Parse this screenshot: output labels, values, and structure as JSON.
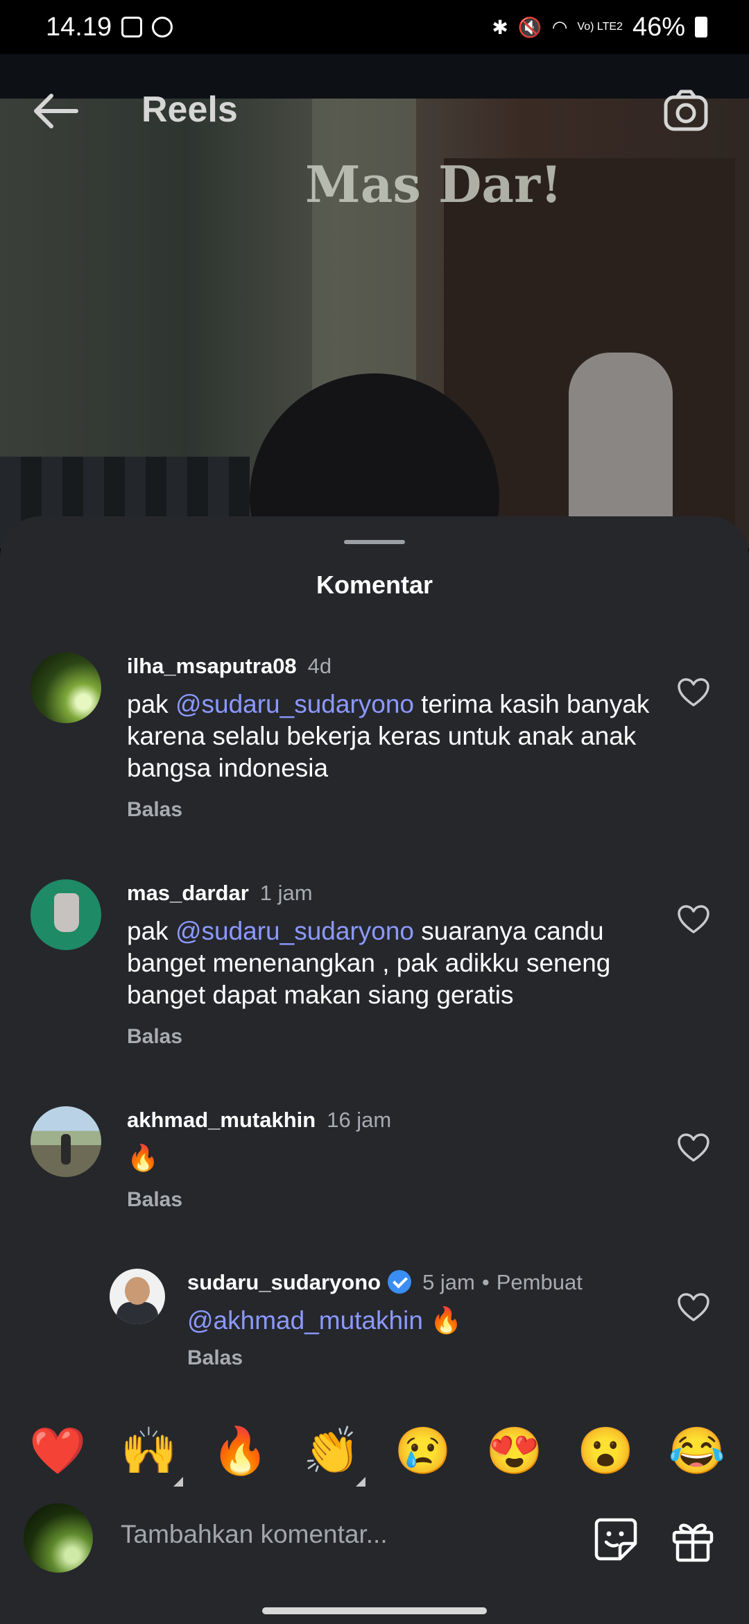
{
  "status_bar": {
    "time": "14.19",
    "battery": "46%",
    "network": "Vo) LTE2"
  },
  "header": {
    "title": "Reels",
    "watermark": "Mas Dar!"
  },
  "sheet": {
    "title": "Komentar"
  },
  "comments": [
    {
      "username": "ilha_msaputra08",
      "time": "4d",
      "mention": "@sudaru_sudaryono",
      "prefix": "pak ",
      "text": " terima kasih banyak karena selalu bekerja keras untuk anak anak bangsa indonesia",
      "reply_label": "Balas"
    },
    {
      "username": "mas_dardar",
      "time": "1 jam",
      "mention": "@sudaru_sudaryono",
      "prefix": "pak ",
      "text": " suaranya candu banget menenangkan , pak adikku seneng banget dapat makan siang geratis",
      "reply_label": "Balas"
    },
    {
      "username": "akhmad_mutakhin",
      "time": "16 jam",
      "text": "🔥",
      "reply_label": "Balas"
    }
  ],
  "reply": {
    "username": "sudaru_sudaryono",
    "time": "5 jam",
    "badge": "Pembuat",
    "mention": "@akhmad_mutakhin",
    "text": " 🔥",
    "reply_label": "Balas"
  },
  "emoji_bar": [
    "❤️",
    "🙌",
    "🔥",
    "👏",
    "😢",
    "😍",
    "😮",
    "😂"
  ],
  "composer": {
    "placeholder": "Tambahkan komentar..."
  },
  "icons": {
    "back": "back-arrow-icon",
    "camera": "camera-icon",
    "like": "heart-outline-icon",
    "sticker": "sticker-icon",
    "gift": "gift-icon"
  },
  "colors": {
    "sheet_bg": "#25272b",
    "mention": "#8c99ff",
    "verified": "#3a8df2",
    "muted_text": "#a8abb0"
  }
}
